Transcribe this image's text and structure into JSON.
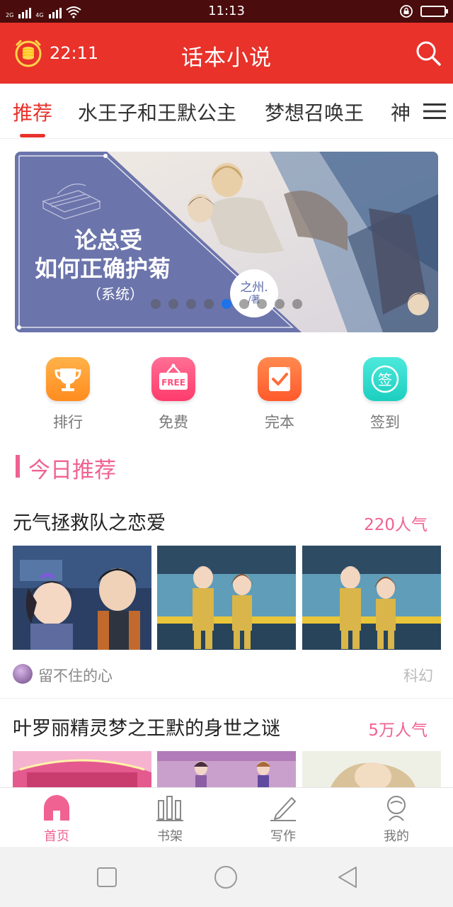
{
  "status_bar": {
    "time": "11:13",
    "network_1": "2G",
    "network_2": "4G",
    "icons": [
      "signal-icon",
      "signal-icon",
      "wifi-icon",
      "rotation-lock-icon",
      "battery-icon"
    ]
  },
  "header": {
    "time": "22:11",
    "title": "话本小说",
    "icons": [
      "coin-alarm-icon",
      "search-icon"
    ]
  },
  "tabs": {
    "items": [
      {
        "label": "推荐",
        "active": true
      },
      {
        "label": "水王子和王默公主",
        "active": false
      },
      {
        "label": "梦想召唤王",
        "active": false
      },
      {
        "label": "神",
        "active": false
      }
    ],
    "menu_icon": "menu-icon"
  },
  "banner": {
    "title_line1": "论总受",
    "title_line2": "如何正确护菊",
    "subtitle": "（系统）",
    "seal_line1": "之州.",
    "seal_line2": "/著",
    "dot_count": 9,
    "active_dot": 5
  },
  "quick_entries": [
    {
      "label": "排行",
      "icon": "trophy-icon",
      "color": "#ff9a2e"
    },
    {
      "label": "免费",
      "icon": "free-sign-icon",
      "color": "#ff4f7c"
    },
    {
      "label": "完本",
      "icon": "check-note-icon",
      "color": "#ff6d3a"
    },
    {
      "label": "签到",
      "icon": "sign-in-icon",
      "color": "#25d7c8"
    }
  ],
  "section": {
    "title": "今日推荐"
  },
  "books": [
    {
      "title": "元气拯救队之恋爱",
      "popularity": "220人气",
      "author": "留不住的心",
      "genre": "科幻"
    },
    {
      "title": "叶罗丽精灵梦之王默的身世之谜",
      "popularity": "5万人气"
    }
  ],
  "bottom_nav": [
    {
      "label": "首页",
      "icon": "home-icon",
      "active": true
    },
    {
      "label": "书架",
      "icon": "bookshelf-icon",
      "active": false
    },
    {
      "label": "写作",
      "icon": "pen-icon",
      "active": false
    },
    {
      "label": "我的",
      "icon": "profile-icon",
      "active": false
    }
  ],
  "colors": {
    "brand_red": "#e8322a",
    "accent_pink": "#f06292",
    "banner_blue": "#6b74ab",
    "active_dot": "#1e73e8"
  }
}
